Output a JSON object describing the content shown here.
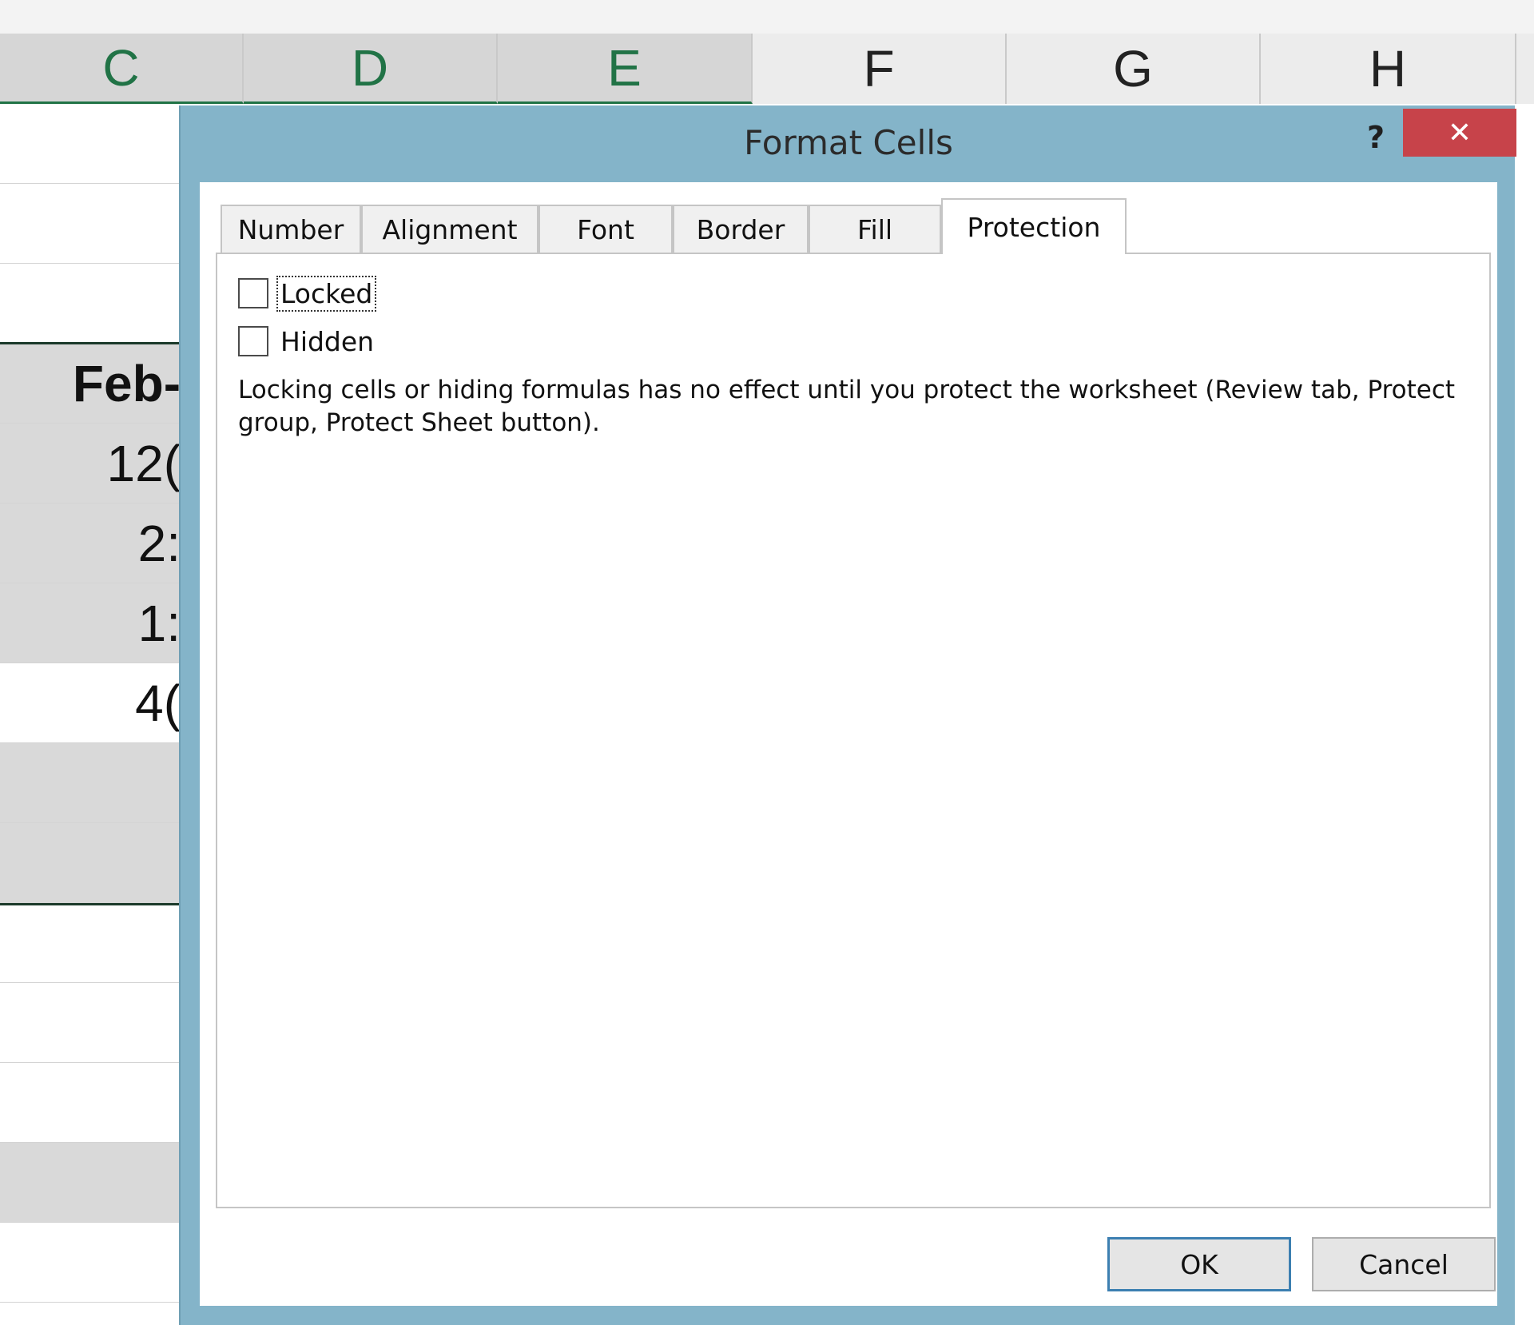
{
  "spreadsheet": {
    "columns": [
      {
        "label": "C",
        "selected": true
      },
      {
        "label": "D",
        "selected": true
      },
      {
        "label": "E",
        "selected": true
      },
      {
        "label": "F",
        "selected": false
      },
      {
        "label": "G",
        "selected": false
      },
      {
        "label": "H",
        "selected": false
      }
    ],
    "row_values": [
      "",
      "",
      "",
      "Feb-",
      "12(",
      "2:",
      "1:",
      "4(",
      "",
      "",
      "",
      "",
      "",
      "",
      ""
    ]
  },
  "dialog": {
    "title": "Format Cells",
    "help_label": "?",
    "close_label": "✕",
    "tabs": [
      {
        "label": "Number",
        "active": false
      },
      {
        "label": "Alignment",
        "active": false
      },
      {
        "label": "Font",
        "active": false
      },
      {
        "label": "Border",
        "active": false
      },
      {
        "label": "Fill",
        "active": false
      },
      {
        "label": "Protection",
        "active": true
      }
    ],
    "protection": {
      "locked": {
        "label": "Locked",
        "checked": false
      },
      "hidden": {
        "label": "Hidden",
        "checked": false
      },
      "info": "Locking cells or hiding formulas has no effect until you protect the worksheet (Review tab, Protect group, Protect Sheet button)."
    },
    "ok_label": "OK",
    "cancel_label": "Cancel"
  },
  "colors": {
    "dialog_frame": "#84b4c9",
    "close_button": "#c7434a",
    "selection_accent": "#217346",
    "default_button_border": "#3c7fb1"
  }
}
